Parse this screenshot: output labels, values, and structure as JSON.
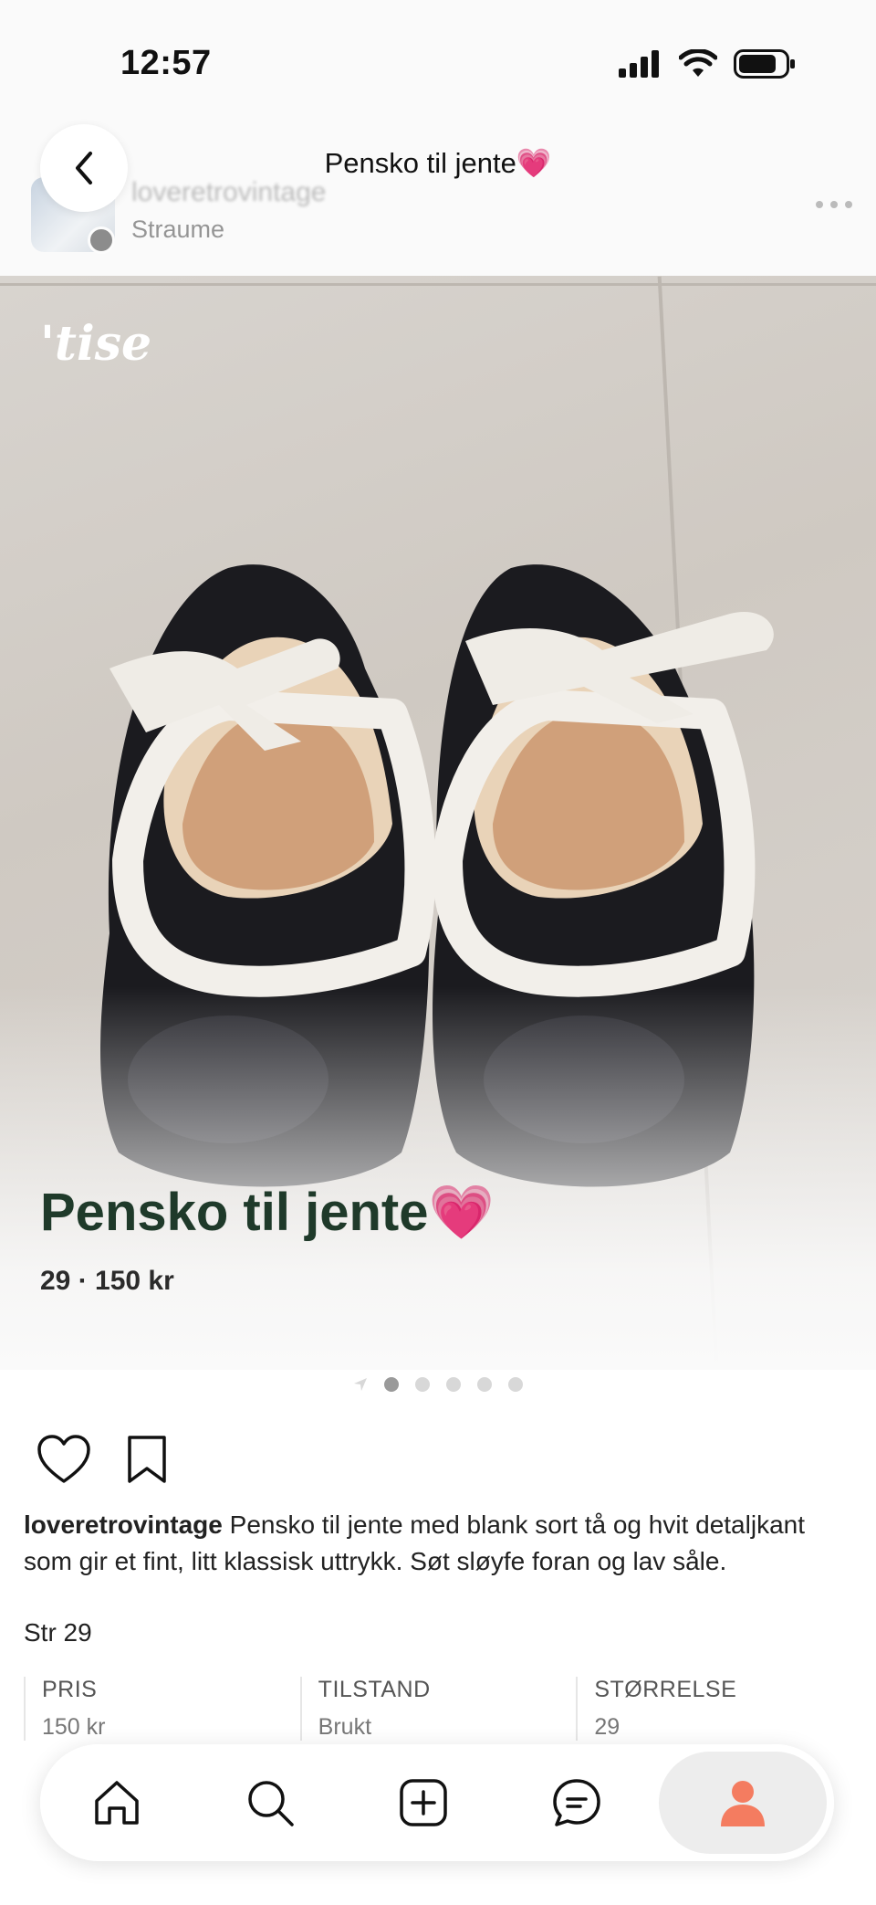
{
  "status_bar": {
    "time": "12:57"
  },
  "header": {
    "title": "Pensko til jente💗",
    "seller_name": "loveretrovintage",
    "seller_location": "Straume"
  },
  "image": {
    "watermark": "'tise",
    "overlay_title": "Pensko til jente💗",
    "overlay_subtitle": "29 · 150 kr",
    "total_images": 5,
    "current_image": 1
  },
  "post": {
    "username": "loveretrovintage",
    "description": " Pensko til jente med blank sort tå og hvit detaljkant som gir et fint, litt klassisk uttrykk. Søt sløyfe foran og lav såle.",
    "size_line": "Str 29"
  },
  "info": [
    {
      "label": "PRIS",
      "value": "150 kr"
    },
    {
      "label": "TILSTAND",
      "value": "Brukt"
    },
    {
      "label": "STØRRELSE",
      "value": "29"
    }
  ],
  "nav": {
    "items": [
      "home-icon",
      "search-icon",
      "add-icon",
      "chat-icon",
      "profile-icon"
    ],
    "accent": "#f47c60"
  }
}
